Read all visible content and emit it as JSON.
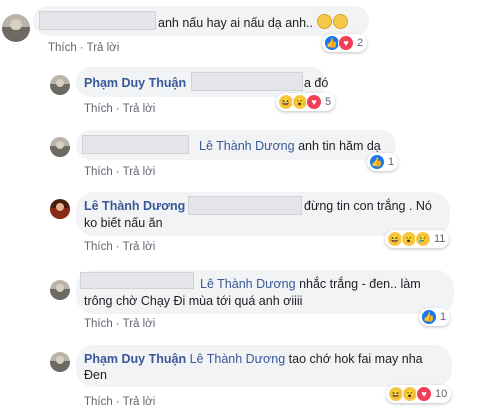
{
  "comments": [
    {
      "text": "anh nấu hay ai nấu dạ anh..",
      "actions": {
        "like": "Thích",
        "reply": "Trả lời"
      },
      "reaction_count": "2"
    },
    {
      "author": "Phạm Duy Thuận",
      "text": "a đó",
      "actions": {
        "like": "Thích",
        "reply": "Trả lời"
      },
      "reaction_count": "5"
    },
    {
      "tag": "Lê Thành Dương",
      "text": "anh tin hăm dạ",
      "actions": {
        "like": "Thích",
        "reply": "Trả lời"
      },
      "reaction_count": "1"
    },
    {
      "author": "Lê Thành Dương",
      "text_line1": "đừng tin con trắng . Nó",
      "text_line2": "ko biết nấu ăn",
      "actions": {
        "like": "Thích",
        "reply": "Trả lời"
      },
      "reaction_count": "11"
    },
    {
      "tag": "Lê Thành Dương",
      "text_line1": "nhắc trắng - đen.. làm",
      "text_line2": "trông chờ Chạy Đi mùa tới quá anh ơiiii",
      "actions": {
        "like": "Thích",
        "reply": "Trả lời"
      },
      "reaction_count": "1"
    },
    {
      "author": "Phạm Duy Thuận",
      "tag": "Lê Thành Dương",
      "text_line1": "tao chớ hok fai may nha",
      "text_line2": "Đen",
      "actions": {
        "like": "Thích",
        "reply": "Trả lời"
      },
      "reaction_count": "10"
    }
  ],
  "colors": {
    "link": "#385898",
    "bubble": "#f2f3f5",
    "like": "#1877f2",
    "love": "#f33e58"
  },
  "icons": [
    "like-icon",
    "love-icon",
    "haha-icon",
    "wow-icon",
    "sad-icon"
  ]
}
